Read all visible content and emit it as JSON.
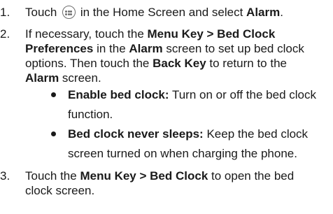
{
  "steps": [
    {
      "number": "1.",
      "text_before_icon": "Touch",
      "icon": "home-screen-apps-icon",
      "text_mid": "in the Home Screen and select",
      "bold_end": "Alarm",
      "end": "."
    },
    {
      "number": "2.",
      "p1": "If necessary, touch the",
      "b1": "Menu Key > Bed Clock Preferences",
      "p2": "in the",
      "b2": "Alarm",
      "p3": "screen to set up bed clock options. Then touch the",
      "b3": "Back Key",
      "p4": "to return to the",
      "b4": "Alarm",
      "p5": "screen.",
      "bullets": [
        {
          "bold": "Enable bed clock:",
          "text": "Turn on or off the bed clock function."
        },
        {
          "bold": "Bed clock never sleeps:",
          "text": "Keep the bed clock screen turned on when charging the phone."
        }
      ]
    },
    {
      "number": "3.",
      "p1": "Touch the",
      "b1": "Menu Key > Bed Clock",
      "p2": "to open the bed clock screen."
    }
  ]
}
